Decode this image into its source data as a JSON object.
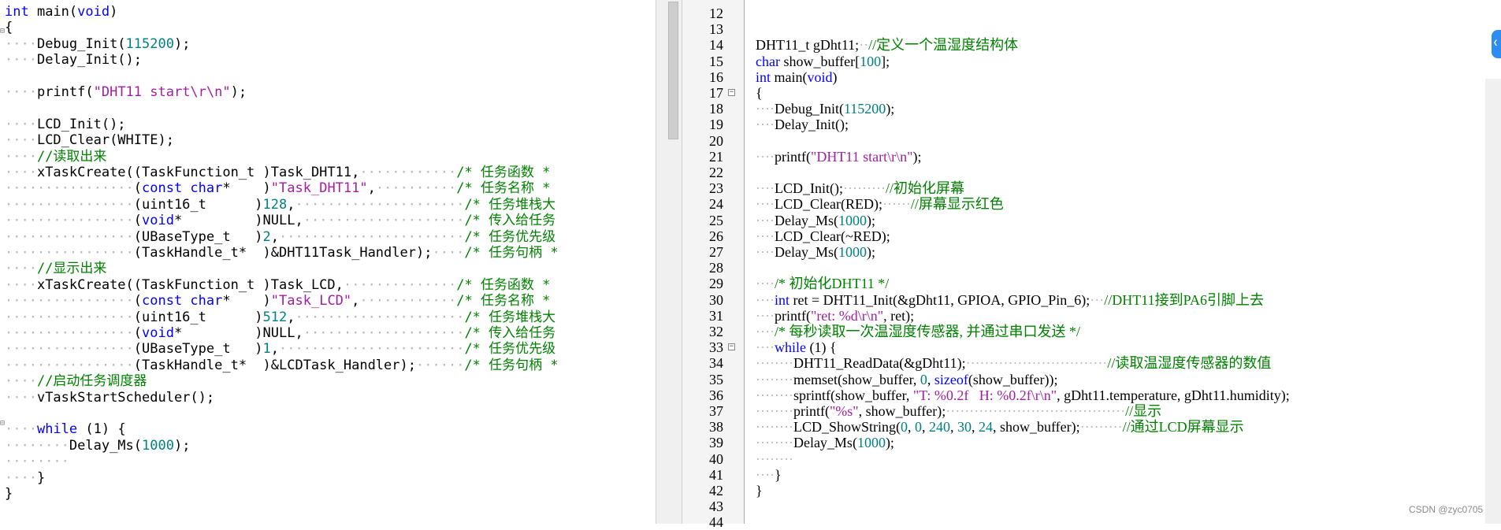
{
  "left_editor": {
    "lines": [
      [
        [
          "kw",
          "int"
        ],
        [
          "t",
          " main("
        ],
        [
          "kw",
          "void"
        ],
        [
          "t",
          ")"
        ]
      ],
      [
        [
          "t",
          "{"
        ]
      ],
      [
        [
          "ws",
          "····"
        ],
        [
          "t",
          "Debug_Init("
        ],
        [
          "num",
          "115200"
        ],
        [
          "t",
          ");"
        ]
      ],
      [
        [
          "ws",
          "····"
        ],
        [
          "t",
          "Delay_Init();"
        ]
      ],
      [
        [
          "t",
          ""
        ]
      ],
      [
        [
          "ws",
          "····"
        ],
        [
          "t",
          "printf("
        ],
        [
          "str",
          "\"DHT11 start\\r\\n\""
        ],
        [
          "t",
          ");"
        ]
      ],
      [
        [
          "t",
          ""
        ]
      ],
      [
        [
          "ws",
          "····"
        ],
        [
          "t",
          "LCD_Init();"
        ]
      ],
      [
        [
          "ws",
          "····"
        ],
        [
          "t",
          "LCD_Clear(WHITE);"
        ]
      ],
      [
        [
          "ws",
          "····"
        ],
        [
          "cmt",
          "//读取出来"
        ]
      ],
      [
        [
          "ws",
          "····"
        ],
        [
          "t",
          "xTaskCreate((TaskFunction_t )Task_DHT11,"
        ],
        [
          "ws",
          "············"
        ],
        [
          "cmt",
          "/* 任务函数 *"
        ]
      ],
      [
        [
          "ws",
          "················"
        ],
        [
          "t",
          "("
        ],
        [
          "kw",
          "const char"
        ],
        [
          "t",
          "*    )"
        ],
        [
          "str",
          "\"Task_DHT11\""
        ],
        [
          "t",
          ","
        ],
        [
          "ws",
          "··········"
        ],
        [
          "cmt",
          "/* 任务名称 *"
        ]
      ],
      [
        [
          "ws",
          "················"
        ],
        [
          "t",
          "(uint16_t      )"
        ],
        [
          "num",
          "128"
        ],
        [
          "t",
          ","
        ],
        [
          "ws",
          "·····················"
        ],
        [
          "cmt",
          "/* 任务堆栈大"
        ]
      ],
      [
        [
          "ws",
          "················"
        ],
        [
          "t",
          "("
        ],
        [
          "kw",
          "void"
        ],
        [
          "t",
          "*         )NULL,"
        ],
        [
          "ws",
          "····················"
        ],
        [
          "cmt",
          "/* 传入给任务"
        ]
      ],
      [
        [
          "ws",
          "················"
        ],
        [
          "t",
          "(UBaseType_t   )"
        ],
        [
          "num",
          "2"
        ],
        [
          "t",
          ","
        ],
        [
          "ws",
          "·······················"
        ],
        [
          "cmt",
          "/* 任务优先级"
        ]
      ],
      [
        [
          "ws",
          "················"
        ],
        [
          "t",
          "(TaskHandle_t*  )&DHT11Task_Handler);"
        ],
        [
          "ws",
          "····"
        ],
        [
          "cmt",
          "/* 任务句柄 *"
        ]
      ],
      [
        [
          "ws",
          "····"
        ],
        [
          "cmt",
          "//显示出来"
        ]
      ],
      [
        [
          "ws",
          "····"
        ],
        [
          "t",
          "xTaskCreate((TaskFunction_t )Task_LCD,"
        ],
        [
          "ws",
          "··············"
        ],
        [
          "cmt",
          "/* 任务函数 *"
        ]
      ],
      [
        [
          "ws",
          "················"
        ],
        [
          "t",
          "("
        ],
        [
          "kw",
          "const char"
        ],
        [
          "t",
          "*    )"
        ],
        [
          "str",
          "\"Task_LCD\""
        ],
        [
          "t",
          ","
        ],
        [
          "ws",
          "············"
        ],
        [
          "cmt",
          "/* 任务名称 *"
        ]
      ],
      [
        [
          "ws",
          "················"
        ],
        [
          "t",
          "(uint16_t      )"
        ],
        [
          "num",
          "512"
        ],
        [
          "t",
          ","
        ],
        [
          "ws",
          "·····················"
        ],
        [
          "cmt",
          "/* 任务堆栈大"
        ]
      ],
      [
        [
          "ws",
          "················"
        ],
        [
          "t",
          "("
        ],
        [
          "kw",
          "void"
        ],
        [
          "t",
          "*         )NULL,"
        ],
        [
          "ws",
          "····················"
        ],
        [
          "cmt",
          "/* 传入给任务"
        ]
      ],
      [
        [
          "ws",
          "················"
        ],
        [
          "t",
          "(UBaseType_t   )"
        ],
        [
          "num",
          "1"
        ],
        [
          "t",
          ","
        ],
        [
          "ws",
          "·······················"
        ],
        [
          "cmt",
          "/* 任务优先级"
        ]
      ],
      [
        [
          "ws",
          "················"
        ],
        [
          "t",
          "(TaskHandle_t*  )&LCDTask_Handler);"
        ],
        [
          "ws",
          "······"
        ],
        [
          "cmt",
          "/* 任务句柄 *"
        ]
      ],
      [
        [
          "ws",
          "····"
        ],
        [
          "cmt",
          "//启动任务调度器"
        ]
      ],
      [
        [
          "ws",
          "····"
        ],
        [
          "t",
          "vTaskStartScheduler();"
        ]
      ],
      [
        [
          "t",
          ""
        ]
      ],
      [
        [
          "ws",
          "····"
        ],
        [
          "kw",
          "while"
        ],
        [
          "t",
          " (1) {"
        ]
      ],
      [
        [
          "ws",
          "········"
        ],
        [
          "t",
          "Delay_Ms("
        ],
        [
          "num",
          "1000"
        ],
        [
          "t",
          ");"
        ]
      ],
      [
        [
          "ws",
          "········"
        ]
      ],
      [
        [
          "ws",
          "····"
        ],
        [
          "t",
          "}"
        ]
      ],
      [
        [
          "t",
          "}"
        ]
      ]
    ]
  },
  "right_editor": {
    "line_numbers": [
      "12",
      "13",
      "14",
      "15",
      "16",
      "17",
      "18",
      "19",
      "20",
      "21",
      "22",
      "23",
      "24",
      "25",
      "26",
      "27",
      "28",
      "29",
      "30",
      "31",
      "32",
      "33",
      "34",
      "35",
      "36",
      "37",
      "38",
      "39",
      "40",
      "41",
      "42",
      "43",
      "44"
    ],
    "fold_markers": {
      "17": "⊟",
      "33": "⊟"
    },
    "lines": [
      [
        [
          "t",
          ""
        ]
      ],
      [
        [
          "t",
          ""
        ]
      ],
      [
        [
          "t",
          "DHT11_t gDht11;"
        ],
        [
          "ws",
          "··"
        ],
        [
          "cmt",
          "//定义一个温湿度结构体"
        ]
      ],
      [
        [
          "kw",
          "char"
        ],
        [
          "t",
          " show_buffer["
        ],
        [
          "num",
          "100"
        ],
        [
          "t",
          "];"
        ]
      ],
      [
        [
          "kw",
          "int"
        ],
        [
          "t",
          " main("
        ],
        [
          "kw",
          "void"
        ],
        [
          "t",
          ")"
        ]
      ],
      [
        [
          "t",
          "{"
        ]
      ],
      [
        [
          "ws",
          "····"
        ],
        [
          "t",
          "Debug_Init("
        ],
        [
          "num",
          "115200"
        ],
        [
          "t",
          ");"
        ]
      ],
      [
        [
          "ws",
          "····"
        ],
        [
          "t",
          "Delay_Init();"
        ]
      ],
      [
        [
          "t",
          ""
        ]
      ],
      [
        [
          "ws",
          "····"
        ],
        [
          "t",
          "printf("
        ],
        [
          "str",
          "\"DHT11 start\\r\\n\""
        ],
        [
          "t",
          ");"
        ]
      ],
      [
        [
          "t",
          ""
        ]
      ],
      [
        [
          "ws",
          "····"
        ],
        [
          "t",
          "LCD_Init();"
        ],
        [
          "ws",
          "·········"
        ],
        [
          "cmt",
          "//初始化屏幕"
        ]
      ],
      [
        [
          "ws",
          "····"
        ],
        [
          "t",
          "LCD_Clear(RED);"
        ],
        [
          "ws",
          "······"
        ],
        [
          "cmt",
          "//屏幕显示红色"
        ]
      ],
      [
        [
          "ws",
          "····"
        ],
        [
          "t",
          "Delay_Ms("
        ],
        [
          "num",
          "1000"
        ],
        [
          "t",
          ");"
        ]
      ],
      [
        [
          "ws",
          "····"
        ],
        [
          "t",
          "LCD_Clear(~RED);"
        ]
      ],
      [
        [
          "ws",
          "····"
        ],
        [
          "t",
          "Delay_Ms("
        ],
        [
          "num",
          "1000"
        ],
        [
          "t",
          ");"
        ]
      ],
      [
        [
          "t",
          ""
        ]
      ],
      [
        [
          "ws",
          "····"
        ],
        [
          "cmt",
          "/* 初始化DHT11 */"
        ]
      ],
      [
        [
          "ws",
          "····"
        ],
        [
          "kw",
          "int"
        ],
        [
          "t",
          " ret = DHT11_Init(&gDht11, GPIOA, GPIO_Pin_6);"
        ],
        [
          "ws",
          "···"
        ],
        [
          "cmt",
          "//DHT11接到PA6引脚上去"
        ]
      ],
      [
        [
          "ws",
          "····"
        ],
        [
          "t",
          "printf("
        ],
        [
          "str",
          "\"ret: %d\\r\\n\""
        ],
        [
          "t",
          ", ret);"
        ]
      ],
      [
        [
          "ws",
          "····"
        ],
        [
          "cmt",
          "/* 每秒读取一次温湿度传感器, 并通过串口发送 */"
        ]
      ],
      [
        [
          "ws",
          "····"
        ],
        [
          "kw",
          "while"
        ],
        [
          "t",
          " (1) {"
        ]
      ],
      [
        [
          "ws",
          "········"
        ],
        [
          "t",
          "DHT11_ReadData(&gDht11);"
        ],
        [
          "ws",
          "······························"
        ],
        [
          "cmt",
          "//读取温湿度传感器的数值"
        ]
      ],
      [
        [
          "ws",
          "········"
        ],
        [
          "t",
          "memset(show_buffer, "
        ],
        [
          "num",
          "0"
        ],
        [
          "t",
          ", "
        ],
        [
          "kw",
          "sizeof"
        ],
        [
          "t",
          "(show_buffer));"
        ]
      ],
      [
        [
          "ws",
          "········"
        ],
        [
          "t",
          "sprintf(show_buffer, "
        ],
        [
          "str",
          "\"T: %0.2f   H: %0.2f\\r\\n\""
        ],
        [
          "t",
          ", gDht11.temperature, gDht11.humidity);"
        ]
      ],
      [
        [
          "ws",
          "········"
        ],
        [
          "t",
          "printf("
        ],
        [
          "str",
          "\"%s\""
        ],
        [
          "t",
          ", show_buffer);"
        ],
        [
          "ws",
          "······································"
        ],
        [
          "cmt",
          "//显示"
        ]
      ],
      [
        [
          "ws",
          "········"
        ],
        [
          "t",
          "LCD_ShowString("
        ],
        [
          "num",
          "0"
        ],
        [
          "t",
          ", "
        ],
        [
          "num",
          "0"
        ],
        [
          "t",
          ", "
        ],
        [
          "num",
          "240"
        ],
        [
          "t",
          ", "
        ],
        [
          "num",
          "30"
        ],
        [
          "t",
          ", "
        ],
        [
          "num",
          "24"
        ],
        [
          "t",
          ", show_buffer);"
        ],
        [
          "ws",
          "·········"
        ],
        [
          "cmt",
          "//通过LCD屏幕显示"
        ]
      ],
      [
        [
          "ws",
          "········"
        ],
        [
          "t",
          "Delay_Ms("
        ],
        [
          "num",
          "1000"
        ],
        [
          "t",
          ");"
        ]
      ],
      [
        [
          "ws",
          "········"
        ]
      ],
      [
        [
          "ws",
          "····"
        ],
        [
          "t",
          "}"
        ]
      ],
      [
        [
          "t",
          "}"
        ]
      ],
      [
        [
          "t",
          ""
        ]
      ],
      [
        [
          "t",
          ""
        ]
      ]
    ]
  },
  "watermark": "CSDN @zyc0705",
  "ui": {
    "blue_tab_glyph": "❮",
    "left_fold_glyph": "⊟"
  },
  "colors": {
    "keyword": "#0000ff",
    "number": "#008080",
    "string": "#a020a0",
    "comment": "#008000",
    "whitespace_dot": "#b8b8b8",
    "accent": "#2f8cf0"
  }
}
